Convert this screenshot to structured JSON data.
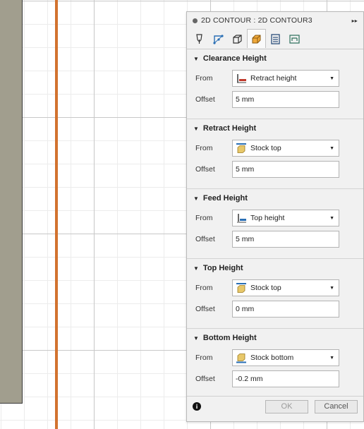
{
  "panel": {
    "title": "2D CONTOUR : 2D CONTOUR3",
    "expand_glyph": "▸▸",
    "tabs": [
      {
        "icon": "tool-icon",
        "active": false
      },
      {
        "icon": "geometry-icon",
        "active": false
      },
      {
        "icon": "heights-3d-icon",
        "active": false
      },
      {
        "icon": "heights-icon",
        "active": true
      },
      {
        "icon": "passes-icon",
        "active": false
      },
      {
        "icon": "linking-icon",
        "active": false
      }
    ],
    "sections": [
      {
        "title": "Clearance Height",
        "from_label": "From",
        "from_value": "Retract height",
        "from_icon": "retract-height-icon",
        "offset_label": "Offset",
        "offset_value": "5 mm"
      },
      {
        "title": "Retract Height",
        "from_label": "From",
        "from_value": "Stock top",
        "from_icon": "stock-top-icon",
        "offset_label": "Offset",
        "offset_value": "5 mm"
      },
      {
        "title": "Feed Height",
        "from_label": "From",
        "from_value": "Top height",
        "from_icon": "top-height-icon",
        "offset_label": "Offset",
        "offset_value": "5 mm"
      },
      {
        "title": "Top Height",
        "from_label": "From",
        "from_value": "Stock top",
        "from_icon": "stock-top-icon",
        "offset_label": "Offset",
        "offset_value": "0 mm"
      },
      {
        "title": "Bottom Height",
        "from_label": "From",
        "from_value": "Stock bottom",
        "from_icon": "stock-bottom-icon",
        "offset_label": "Offset",
        "offset_value": "-0.2 mm"
      }
    ],
    "footer": {
      "info_glyph": "i",
      "ok_label": "OK",
      "cancel_label": "Cancel"
    }
  },
  "colors": {
    "tool_line": "#d2722f",
    "stock_block": "#a19e8e",
    "accent_blue": "#2a6fb5"
  }
}
